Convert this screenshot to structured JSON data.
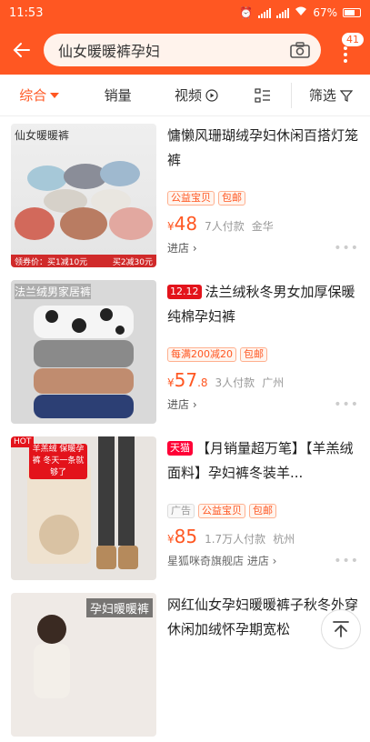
{
  "status": {
    "time": "11:53",
    "battery": "67%"
  },
  "search": {
    "query": "仙女暖暖裤孕妇",
    "badge": "41"
  },
  "sort": {
    "items": [
      "综合",
      "销量",
      "视频",
      "筛选"
    ]
  },
  "products": [
    {
      "title": "慵懒风珊瑚绒孕妇休闲百搭灯笼裤",
      "pre_tag": "",
      "tags": [
        "公益宝贝",
        "包邮"
      ],
      "price_yen": "¥",
      "price_int": "48",
      "price_dec": "",
      "sold": "7人付款",
      "location": "金华",
      "shop": "进店",
      "image_label": "仙女暖暖裤",
      "caption_left": "领券价：买1减10元",
      "caption_right": "买2减30元"
    },
    {
      "title": "法兰绒秋冬男女加厚保暖纯棉孕妇裤",
      "pre_tag": "12.12",
      "tags": [
        "每满200减20",
        "包邮"
      ],
      "price_yen": "¥",
      "price_int": "57",
      "price_dec": ".8",
      "sold": "3人付款",
      "location": "广州",
      "shop": "进店",
      "image_label": "法兰绒男家居裤"
    },
    {
      "title": "【月销量超万笔】【羊羔绒面料】孕妇裤冬装羊...",
      "pre_tag": "天猫",
      "ad": "广告",
      "tags": [
        "公益宝贝",
        "包邮"
      ],
      "price_yen": "¥",
      "price_int": "85",
      "price_dec": "",
      "sold": "1.7万人付款",
      "location": "杭州",
      "shop": "星狐咪奇旗舰店 进店",
      "image_label": "羊羔绒 保暖孕裤 冬天一条就够了",
      "image_hot": "HOT"
    },
    {
      "title": "网红仙女孕妇暖暖裤子秋冬外穿休闲加绒怀孕期宽松",
      "image_label": "孕妇暖暖裤"
    }
  ]
}
